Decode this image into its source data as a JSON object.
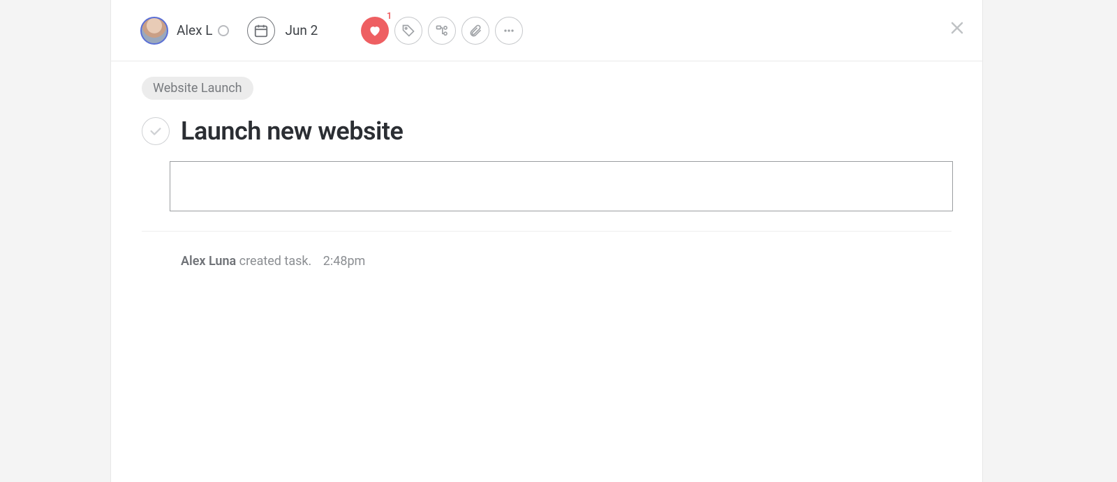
{
  "header": {
    "assignee_name": "Alex L",
    "due_date": "Jun 2",
    "like_count": "1"
  },
  "task": {
    "project_chip": "Website Launch",
    "title": "Launch new website",
    "description": ""
  },
  "activity": {
    "actor": "Alex Luna",
    "action": " created task.",
    "time": "2:48pm"
  }
}
